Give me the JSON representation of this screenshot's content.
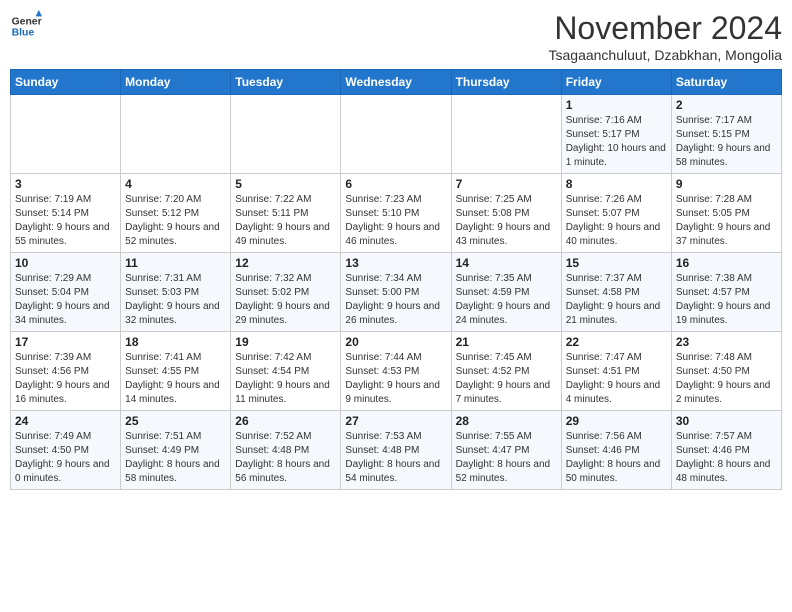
{
  "logo": {
    "line1": "General",
    "line2": "Blue"
  },
  "title": "November 2024",
  "subtitle": "Tsagaanchuluut, Dzabkhan, Mongolia",
  "weekdays": [
    "Sunday",
    "Monday",
    "Tuesday",
    "Wednesday",
    "Thursday",
    "Friday",
    "Saturday"
  ],
  "weeks": [
    [
      {
        "day": "",
        "info": ""
      },
      {
        "day": "",
        "info": ""
      },
      {
        "day": "",
        "info": ""
      },
      {
        "day": "",
        "info": ""
      },
      {
        "day": "",
        "info": ""
      },
      {
        "day": "1",
        "info": "Sunrise: 7:16 AM\nSunset: 5:17 PM\nDaylight: 10 hours and 1 minute."
      },
      {
        "day": "2",
        "info": "Sunrise: 7:17 AM\nSunset: 5:15 PM\nDaylight: 9 hours and 58 minutes."
      }
    ],
    [
      {
        "day": "3",
        "info": "Sunrise: 7:19 AM\nSunset: 5:14 PM\nDaylight: 9 hours and 55 minutes."
      },
      {
        "day": "4",
        "info": "Sunrise: 7:20 AM\nSunset: 5:12 PM\nDaylight: 9 hours and 52 minutes."
      },
      {
        "day": "5",
        "info": "Sunrise: 7:22 AM\nSunset: 5:11 PM\nDaylight: 9 hours and 49 minutes."
      },
      {
        "day": "6",
        "info": "Sunrise: 7:23 AM\nSunset: 5:10 PM\nDaylight: 9 hours and 46 minutes."
      },
      {
        "day": "7",
        "info": "Sunrise: 7:25 AM\nSunset: 5:08 PM\nDaylight: 9 hours and 43 minutes."
      },
      {
        "day": "8",
        "info": "Sunrise: 7:26 AM\nSunset: 5:07 PM\nDaylight: 9 hours and 40 minutes."
      },
      {
        "day": "9",
        "info": "Sunrise: 7:28 AM\nSunset: 5:05 PM\nDaylight: 9 hours and 37 minutes."
      }
    ],
    [
      {
        "day": "10",
        "info": "Sunrise: 7:29 AM\nSunset: 5:04 PM\nDaylight: 9 hours and 34 minutes."
      },
      {
        "day": "11",
        "info": "Sunrise: 7:31 AM\nSunset: 5:03 PM\nDaylight: 9 hours and 32 minutes."
      },
      {
        "day": "12",
        "info": "Sunrise: 7:32 AM\nSunset: 5:02 PM\nDaylight: 9 hours and 29 minutes."
      },
      {
        "day": "13",
        "info": "Sunrise: 7:34 AM\nSunset: 5:00 PM\nDaylight: 9 hours and 26 minutes."
      },
      {
        "day": "14",
        "info": "Sunrise: 7:35 AM\nSunset: 4:59 PM\nDaylight: 9 hours and 24 minutes."
      },
      {
        "day": "15",
        "info": "Sunrise: 7:37 AM\nSunset: 4:58 PM\nDaylight: 9 hours and 21 minutes."
      },
      {
        "day": "16",
        "info": "Sunrise: 7:38 AM\nSunset: 4:57 PM\nDaylight: 9 hours and 19 minutes."
      }
    ],
    [
      {
        "day": "17",
        "info": "Sunrise: 7:39 AM\nSunset: 4:56 PM\nDaylight: 9 hours and 16 minutes."
      },
      {
        "day": "18",
        "info": "Sunrise: 7:41 AM\nSunset: 4:55 PM\nDaylight: 9 hours and 14 minutes."
      },
      {
        "day": "19",
        "info": "Sunrise: 7:42 AM\nSunset: 4:54 PM\nDaylight: 9 hours and 11 minutes."
      },
      {
        "day": "20",
        "info": "Sunrise: 7:44 AM\nSunset: 4:53 PM\nDaylight: 9 hours and 9 minutes."
      },
      {
        "day": "21",
        "info": "Sunrise: 7:45 AM\nSunset: 4:52 PM\nDaylight: 9 hours and 7 minutes."
      },
      {
        "day": "22",
        "info": "Sunrise: 7:47 AM\nSunset: 4:51 PM\nDaylight: 9 hours and 4 minutes."
      },
      {
        "day": "23",
        "info": "Sunrise: 7:48 AM\nSunset: 4:50 PM\nDaylight: 9 hours and 2 minutes."
      }
    ],
    [
      {
        "day": "24",
        "info": "Sunrise: 7:49 AM\nSunset: 4:50 PM\nDaylight: 9 hours and 0 minutes."
      },
      {
        "day": "25",
        "info": "Sunrise: 7:51 AM\nSunset: 4:49 PM\nDaylight: 8 hours and 58 minutes."
      },
      {
        "day": "26",
        "info": "Sunrise: 7:52 AM\nSunset: 4:48 PM\nDaylight: 8 hours and 56 minutes."
      },
      {
        "day": "27",
        "info": "Sunrise: 7:53 AM\nSunset: 4:48 PM\nDaylight: 8 hours and 54 minutes."
      },
      {
        "day": "28",
        "info": "Sunrise: 7:55 AM\nSunset: 4:47 PM\nDaylight: 8 hours and 52 minutes."
      },
      {
        "day": "29",
        "info": "Sunrise: 7:56 AM\nSunset: 4:46 PM\nDaylight: 8 hours and 50 minutes."
      },
      {
        "day": "30",
        "info": "Sunrise: 7:57 AM\nSunset: 4:46 PM\nDaylight: 8 hours and 48 minutes."
      }
    ]
  ]
}
